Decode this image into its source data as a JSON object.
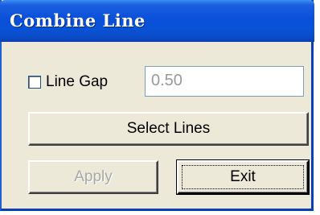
{
  "window": {
    "title": "Combine Line"
  },
  "line_gap": {
    "label": "Line Gap",
    "checked": false,
    "value": "0.50"
  },
  "buttons": {
    "select_lines": "Select Lines",
    "apply": "Apply",
    "exit": "Exit"
  },
  "colors": {
    "titlebar": "#0a4fd9",
    "dialog_bg": "#ece9d8",
    "disabled_text": "#a8a8a8"
  }
}
